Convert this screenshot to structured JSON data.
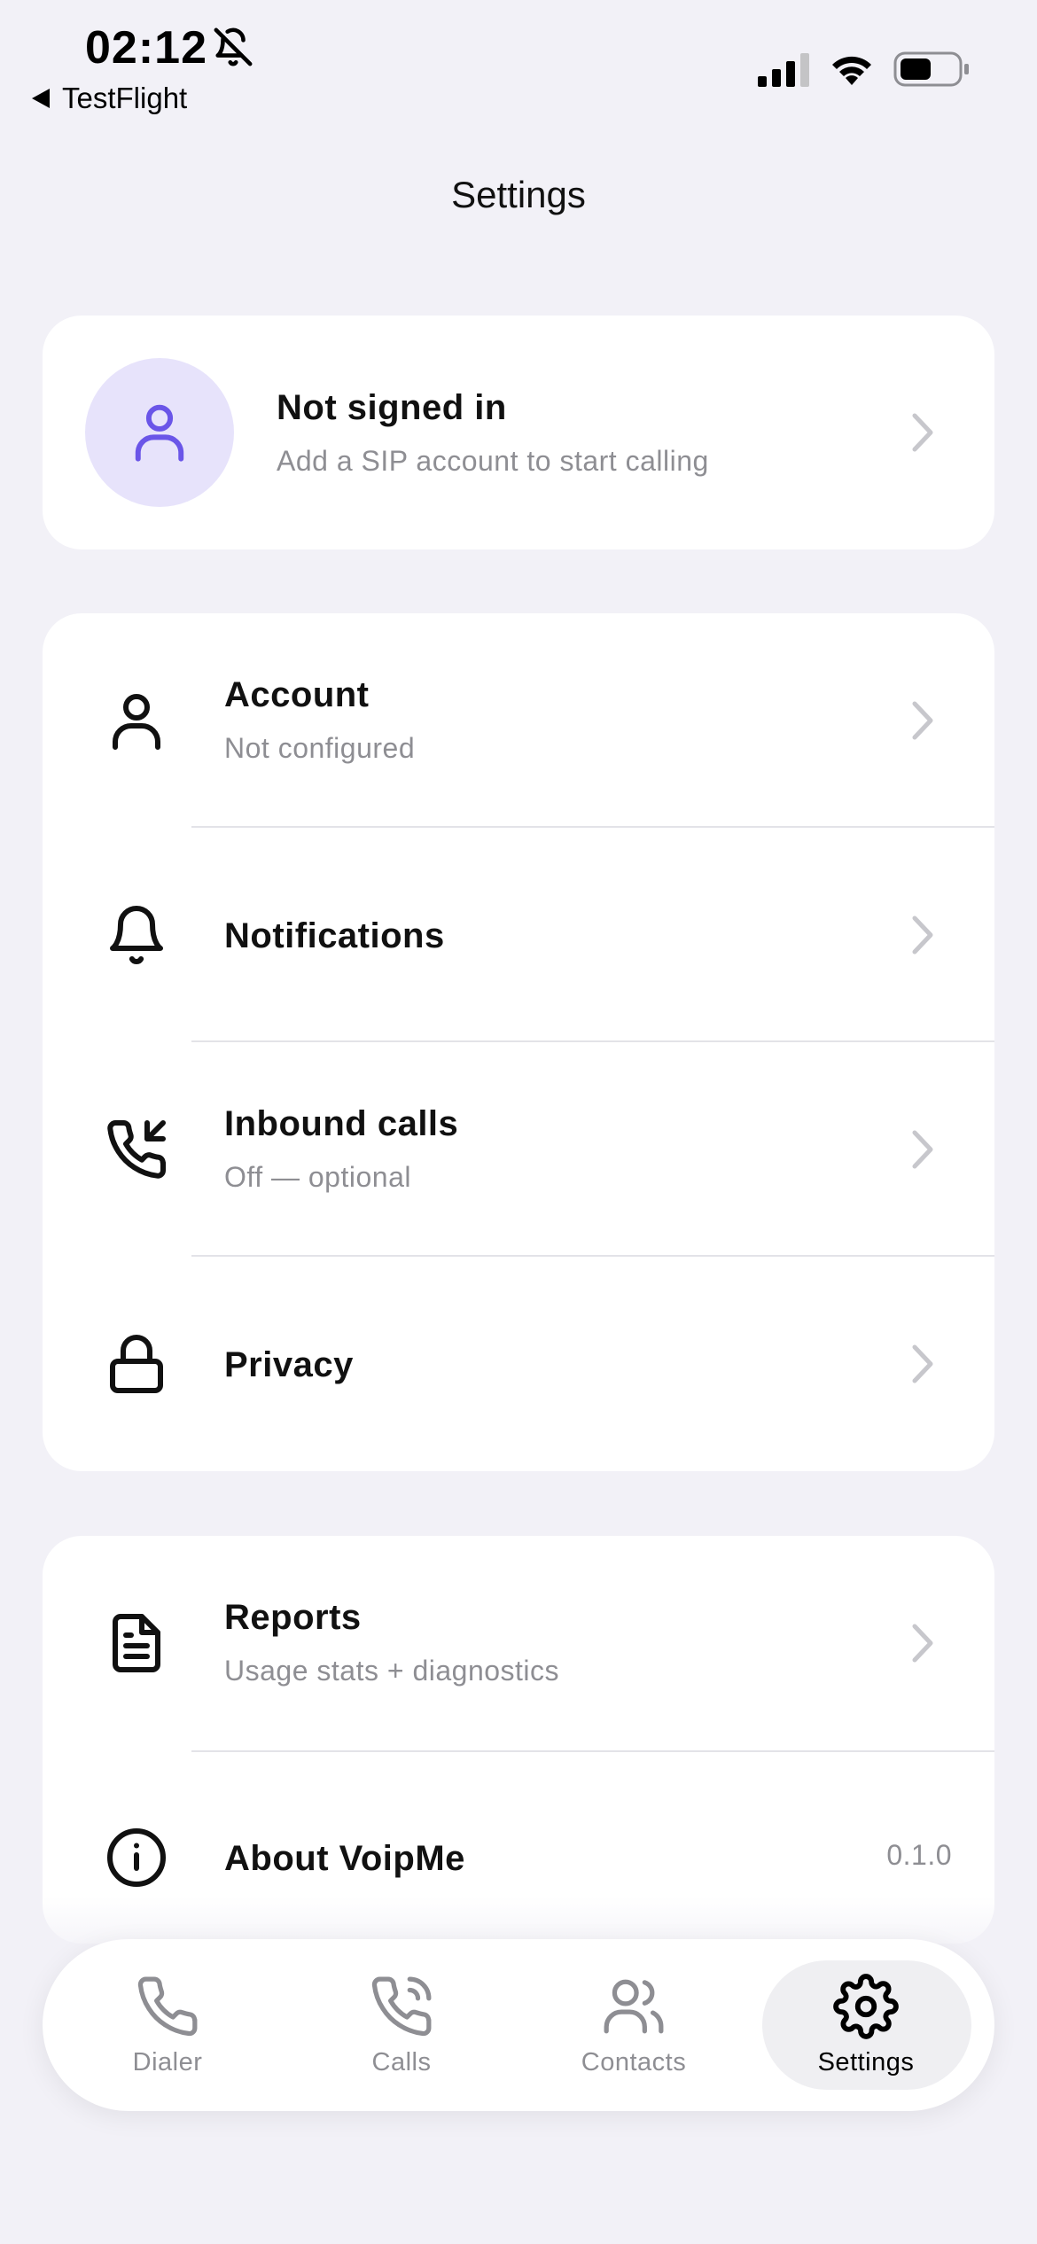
{
  "status_bar": {
    "time": "02:12",
    "back_app": "TestFlight"
  },
  "header": {
    "title": "Settings"
  },
  "profile": {
    "title": "Not signed in",
    "subtitle": "Add a SIP account to start calling"
  },
  "settings": {
    "items": [
      {
        "label": "Account",
        "subtitle": "Not configured",
        "icon": "person-icon"
      },
      {
        "label": "Notifications",
        "subtitle": "",
        "icon": "bell-icon"
      },
      {
        "label": "Inbound calls",
        "subtitle": "Off — optional",
        "icon": "phone-incoming-icon"
      },
      {
        "label": "Privacy",
        "subtitle": "",
        "icon": "lock-icon"
      }
    ]
  },
  "about": {
    "items": [
      {
        "label": "Reports",
        "subtitle": "Usage stats + diagnostics",
        "icon": "document-icon"
      },
      {
        "label": "About VoipMe",
        "value": "0.1.0",
        "icon": "info-icon"
      }
    ]
  },
  "tab_bar": {
    "tabs": [
      {
        "label": "Dialer",
        "icon": "phone-icon",
        "active": false
      },
      {
        "label": "Calls",
        "icon": "phone-calls-icon",
        "active": false
      },
      {
        "label": "Contacts",
        "icon": "contacts-icon",
        "active": false
      },
      {
        "label": "Settings",
        "icon": "gear-icon",
        "active": true
      }
    ]
  },
  "colors": {
    "background": "#f2f1f7",
    "card": "#ffffff",
    "accent": "#6a55e8",
    "avatar_bg": "#e7e3fb",
    "secondary_text": "#8e8e93",
    "inactive_tab": "#8e8e93"
  }
}
